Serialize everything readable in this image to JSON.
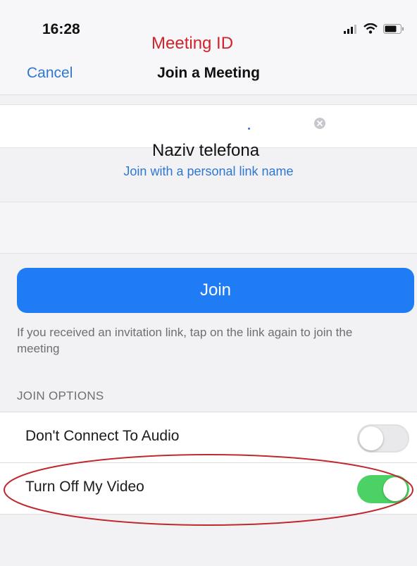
{
  "status_bar": {
    "time": "16:28",
    "icons": [
      "cellular-signal-icon",
      "wifi-icon",
      "battery-icon"
    ]
  },
  "nav": {
    "cancel_label": "Cancel",
    "title": "Join a Meeting"
  },
  "annotations": {
    "meeting_id_label": "Meeting ID",
    "phone_name_label": "Naziv  telefona",
    "highlight_color": "#c0282d"
  },
  "meeting_id_field": {
    "value": "",
    "clear_icon": "clear-circle-icon"
  },
  "personal_link": {
    "label": "Join with a personal link name"
  },
  "name_field": {
    "value": ""
  },
  "join_button": {
    "label": "Join",
    "color": "#1f7cf5"
  },
  "help_text": "If you received an invitation link, tap on the link again to join the meeting",
  "join_options": {
    "header": "JOIN OPTIONS",
    "items": [
      {
        "label": "Don't Connect To Audio",
        "enabled": false
      },
      {
        "label": "Turn Off My Video",
        "enabled": true
      }
    ],
    "toggle_on_color": "#4cd264"
  }
}
